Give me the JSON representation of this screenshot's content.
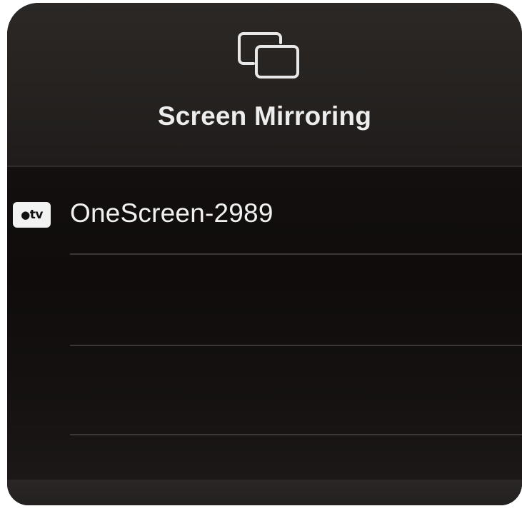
{
  "sheet": {
    "title": "Screen Mirroring",
    "icon": "screen-mirroring-icon"
  },
  "devices": [
    {
      "name": "OneScreen-2989",
      "icon": "apple-tv-icon",
      "icon_label": "tv"
    }
  ],
  "colors": {
    "panel_background": "#120f0e",
    "header_background": "#252220",
    "text": "#ededed",
    "divider": "#3a3736"
  }
}
